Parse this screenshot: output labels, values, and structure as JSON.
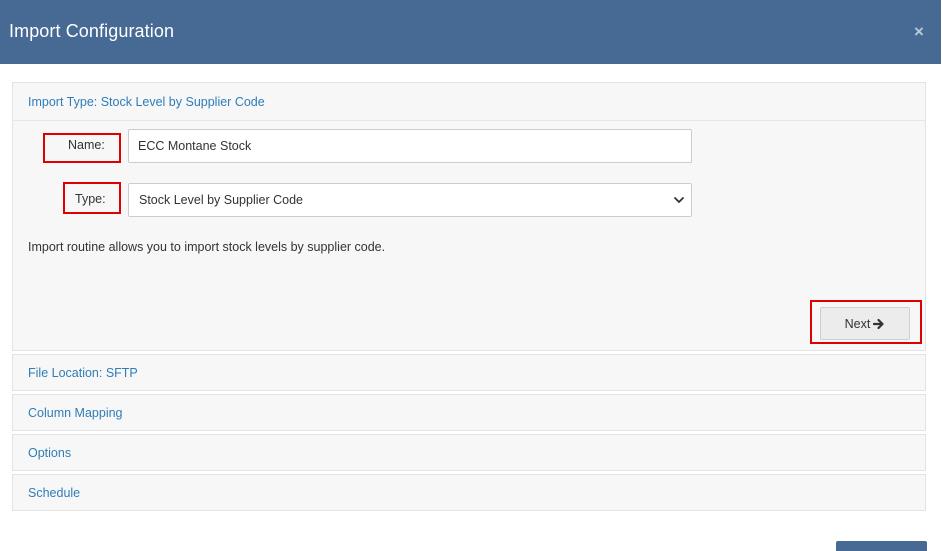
{
  "dialog": {
    "title": "Import Configuration",
    "close_glyph": "×"
  },
  "sections": {
    "import_type": {
      "heading": "Import Type: Stock Level by Supplier Code",
      "name_label": "Name:",
      "name_value": "ECC Montane Stock",
      "type_label": "Type:",
      "type_value": "Stock Level by Supplier Code",
      "description": "Import routine allows you to import stock levels by supplier code.",
      "next_label": "Next"
    },
    "file_location": {
      "heading": "File Location: SFTP"
    },
    "column_mapping": {
      "heading": "Column Mapping"
    },
    "options": {
      "heading": "Options"
    },
    "schedule": {
      "heading": "Schedule"
    }
  },
  "colors": {
    "header_bg": "#466a93",
    "link": "#2e7db8",
    "highlight": "#e00000"
  },
  "icons": {
    "close": "close-icon",
    "select_caret": "chevron-down-icon",
    "next_arrow": "arrow-right-icon"
  }
}
